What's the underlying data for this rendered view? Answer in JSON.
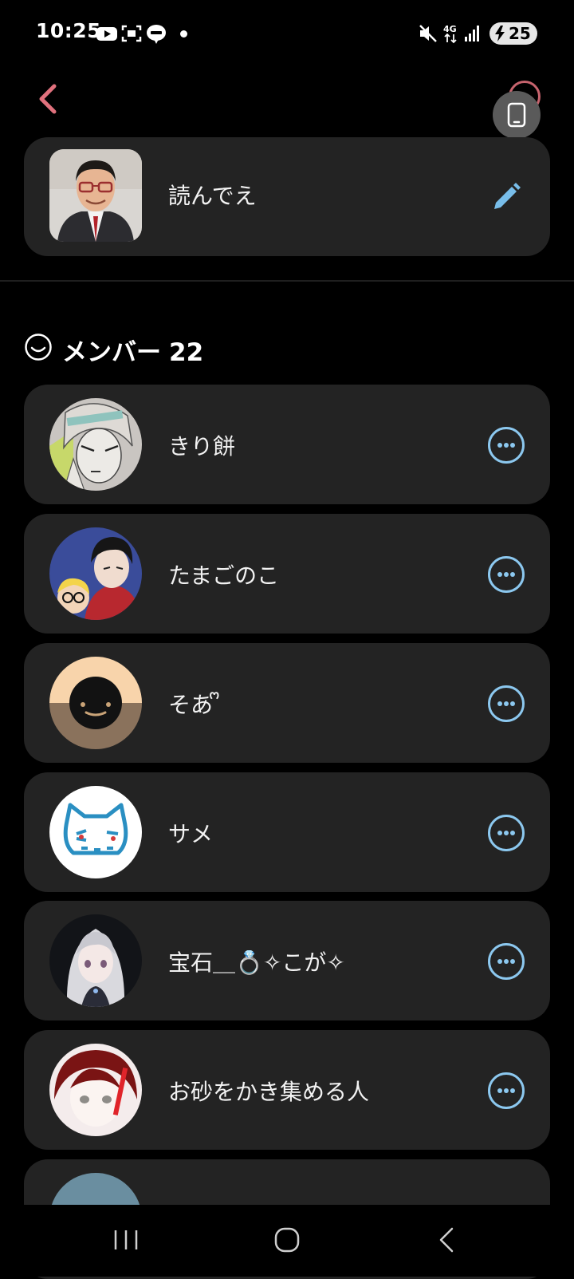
{
  "status_bar": {
    "time": "10:25",
    "battery": "25",
    "icons": [
      "youtube-icon",
      "screenshot-icon",
      "line-icon",
      "dot-icon",
      "mute-icon",
      "network-4g-icon",
      "signal-icon",
      "battery-icon"
    ]
  },
  "header": {
    "back_icon": "chevron-left-icon",
    "accent_color": "#e0717d"
  },
  "group": {
    "name": "読んでえ",
    "edit_icon": "pencil-icon"
  },
  "members": {
    "label": "メンバー",
    "count": "22",
    "items": [
      {
        "name": "きり餅"
      },
      {
        "name": "たまごのこ"
      },
      {
        "name": "そあ ᩚ"
      },
      {
        "name": "サメ"
      },
      {
        "name": "宝石＿💍✧こが✧"
      },
      {
        "name": "お砂をかき集める人"
      }
    ]
  },
  "colors": {
    "background": "#000000",
    "card": "#232323",
    "more_button": "#8cc8ef",
    "edit_icon": "#78bde9"
  },
  "nav_bar": {
    "icons": [
      "recent-apps-icon",
      "home-icon",
      "back-icon"
    ]
  }
}
